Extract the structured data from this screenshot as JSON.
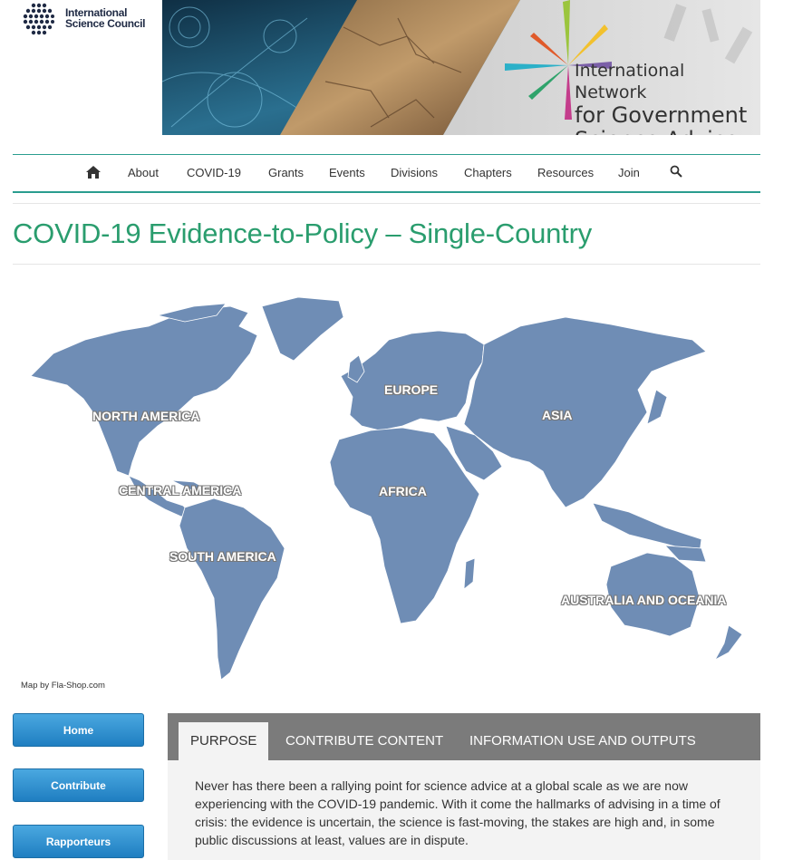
{
  "header": {
    "isc_logo": {
      "line1": "International",
      "line2": "Science Council"
    },
    "banner": {
      "line1": "International Network",
      "line2": "for Government",
      "line3": "Science Advice"
    }
  },
  "nav": {
    "items": [
      "About",
      "COVID-19",
      "Grants",
      "Events",
      "Divisions",
      "Chapters",
      "Resources",
      "Join"
    ],
    "home_icon": "home-icon",
    "search_icon": "search-icon"
  },
  "page": {
    "title": "COVID-19 Evidence-to-Policy – Single-Country"
  },
  "map": {
    "regions": [
      "NORTH AMERICA",
      "EUROPE",
      "ASIA",
      "CENTRAL AMERICA",
      "AFRICA",
      "SOUTH AMERICA",
      "AUSTRALIA AND OCEANIA"
    ],
    "credit": "Map by Fla-Shop.com",
    "color": "#6f8db5"
  },
  "sidebar": {
    "buttons": [
      "Home",
      "Contribute",
      "Rapporteurs"
    ]
  },
  "tabs": {
    "items": [
      "PURPOSE",
      "CONTRIBUTE CONTENT",
      "INFORMATION USE AND OUTPUTS"
    ],
    "active": "PURPOSE",
    "content": "Never has there been a rallying point for science advice at a global scale as we are now experiencing with the COVID-19 pandemic.  With it come the hallmarks of advising in a time of crisis:  the evidence is uncertain, the science is fast-moving, the stakes are high and, in some public discussions at least, values are in dispute."
  },
  "colors": {
    "accent": "#2a9d6e",
    "nav_border": "#2a9d8f",
    "button": "#2a8fd3",
    "tab_bar": "#7b7b7b"
  }
}
